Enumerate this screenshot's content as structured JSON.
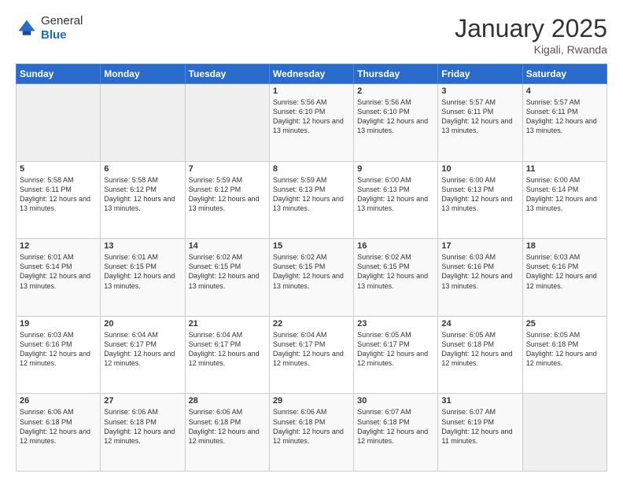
{
  "header": {
    "logo_general": "General",
    "logo_blue": "Blue",
    "title": "January 2025",
    "subtitle": "Kigali, Rwanda"
  },
  "weekdays": [
    "Sunday",
    "Monday",
    "Tuesday",
    "Wednesday",
    "Thursday",
    "Friday",
    "Saturday"
  ],
  "weeks": [
    [
      {
        "day": "",
        "info": ""
      },
      {
        "day": "",
        "info": ""
      },
      {
        "day": "",
        "info": ""
      },
      {
        "day": "1",
        "info": "Sunrise: 5:56 AM\nSunset: 6:10 PM\nDaylight: 12 hours\nand 13 minutes."
      },
      {
        "day": "2",
        "info": "Sunrise: 5:56 AM\nSunset: 6:10 PM\nDaylight: 12 hours\nand 13 minutes."
      },
      {
        "day": "3",
        "info": "Sunrise: 5:57 AM\nSunset: 6:11 PM\nDaylight: 12 hours\nand 13 minutes."
      },
      {
        "day": "4",
        "info": "Sunrise: 5:57 AM\nSunset: 6:11 PM\nDaylight: 12 hours\nand 13 minutes."
      }
    ],
    [
      {
        "day": "5",
        "info": "Sunrise: 5:58 AM\nSunset: 6:11 PM\nDaylight: 12 hours\nand 13 minutes."
      },
      {
        "day": "6",
        "info": "Sunrise: 5:58 AM\nSunset: 6:12 PM\nDaylight: 12 hours\nand 13 minutes."
      },
      {
        "day": "7",
        "info": "Sunrise: 5:59 AM\nSunset: 6:12 PM\nDaylight: 12 hours\nand 13 minutes."
      },
      {
        "day": "8",
        "info": "Sunrise: 5:59 AM\nSunset: 6:13 PM\nDaylight: 12 hours\nand 13 minutes."
      },
      {
        "day": "9",
        "info": "Sunrise: 6:00 AM\nSunset: 6:13 PM\nDaylight: 12 hours\nand 13 minutes."
      },
      {
        "day": "10",
        "info": "Sunrise: 6:00 AM\nSunset: 6:13 PM\nDaylight: 12 hours\nand 13 minutes."
      },
      {
        "day": "11",
        "info": "Sunrise: 6:00 AM\nSunset: 6:14 PM\nDaylight: 12 hours\nand 13 minutes."
      }
    ],
    [
      {
        "day": "12",
        "info": "Sunrise: 6:01 AM\nSunset: 6:14 PM\nDaylight: 12 hours\nand 13 minutes."
      },
      {
        "day": "13",
        "info": "Sunrise: 6:01 AM\nSunset: 6:15 PM\nDaylight: 12 hours\nand 13 minutes."
      },
      {
        "day": "14",
        "info": "Sunrise: 6:02 AM\nSunset: 6:15 PM\nDaylight: 12 hours\nand 13 minutes."
      },
      {
        "day": "15",
        "info": "Sunrise: 6:02 AM\nSunset: 6:15 PM\nDaylight: 12 hours\nand 13 minutes."
      },
      {
        "day": "16",
        "info": "Sunrise: 6:02 AM\nSunset: 6:15 PM\nDaylight: 12 hours\nand 13 minutes."
      },
      {
        "day": "17",
        "info": "Sunrise: 6:03 AM\nSunset: 6:16 PM\nDaylight: 12 hours\nand 13 minutes."
      },
      {
        "day": "18",
        "info": "Sunrise: 6:03 AM\nSunset: 6:16 PM\nDaylight: 12 hours\nand 12 minutes."
      }
    ],
    [
      {
        "day": "19",
        "info": "Sunrise: 6:03 AM\nSunset: 6:16 PM\nDaylight: 12 hours\nand 12 minutes."
      },
      {
        "day": "20",
        "info": "Sunrise: 6:04 AM\nSunset: 6:17 PM\nDaylight: 12 hours\nand 12 minutes."
      },
      {
        "day": "21",
        "info": "Sunrise: 6:04 AM\nSunset: 6:17 PM\nDaylight: 12 hours\nand 12 minutes."
      },
      {
        "day": "22",
        "info": "Sunrise: 6:04 AM\nSunset: 6:17 PM\nDaylight: 12 hours\nand 12 minutes."
      },
      {
        "day": "23",
        "info": "Sunrise: 6:05 AM\nSunset: 6:17 PM\nDaylight: 12 hours\nand 12 minutes."
      },
      {
        "day": "24",
        "info": "Sunrise: 6:05 AM\nSunset: 6:18 PM\nDaylight: 12 hours\nand 12 minutes."
      },
      {
        "day": "25",
        "info": "Sunrise: 6:05 AM\nSunset: 6:18 PM\nDaylight: 12 hours\nand 12 minutes."
      }
    ],
    [
      {
        "day": "26",
        "info": "Sunrise: 6:06 AM\nSunset: 6:18 PM\nDaylight: 12 hours\nand 12 minutes."
      },
      {
        "day": "27",
        "info": "Sunrise: 6:06 AM\nSunset: 6:18 PM\nDaylight: 12 hours\nand 12 minutes."
      },
      {
        "day": "28",
        "info": "Sunrise: 6:06 AM\nSunset: 6:18 PM\nDaylight: 12 hours\nand 12 minutes."
      },
      {
        "day": "29",
        "info": "Sunrise: 6:06 AM\nSunset: 6:18 PM\nDaylight: 12 hours\nand 12 minutes."
      },
      {
        "day": "30",
        "info": "Sunrise: 6:07 AM\nSunset: 6:18 PM\nDaylight: 12 hours\nand 12 minutes."
      },
      {
        "day": "31",
        "info": "Sunrise: 6:07 AM\nSunset: 6:19 PM\nDaylight: 12 hours\nand 11 minutes."
      },
      {
        "day": "",
        "info": ""
      }
    ]
  ]
}
